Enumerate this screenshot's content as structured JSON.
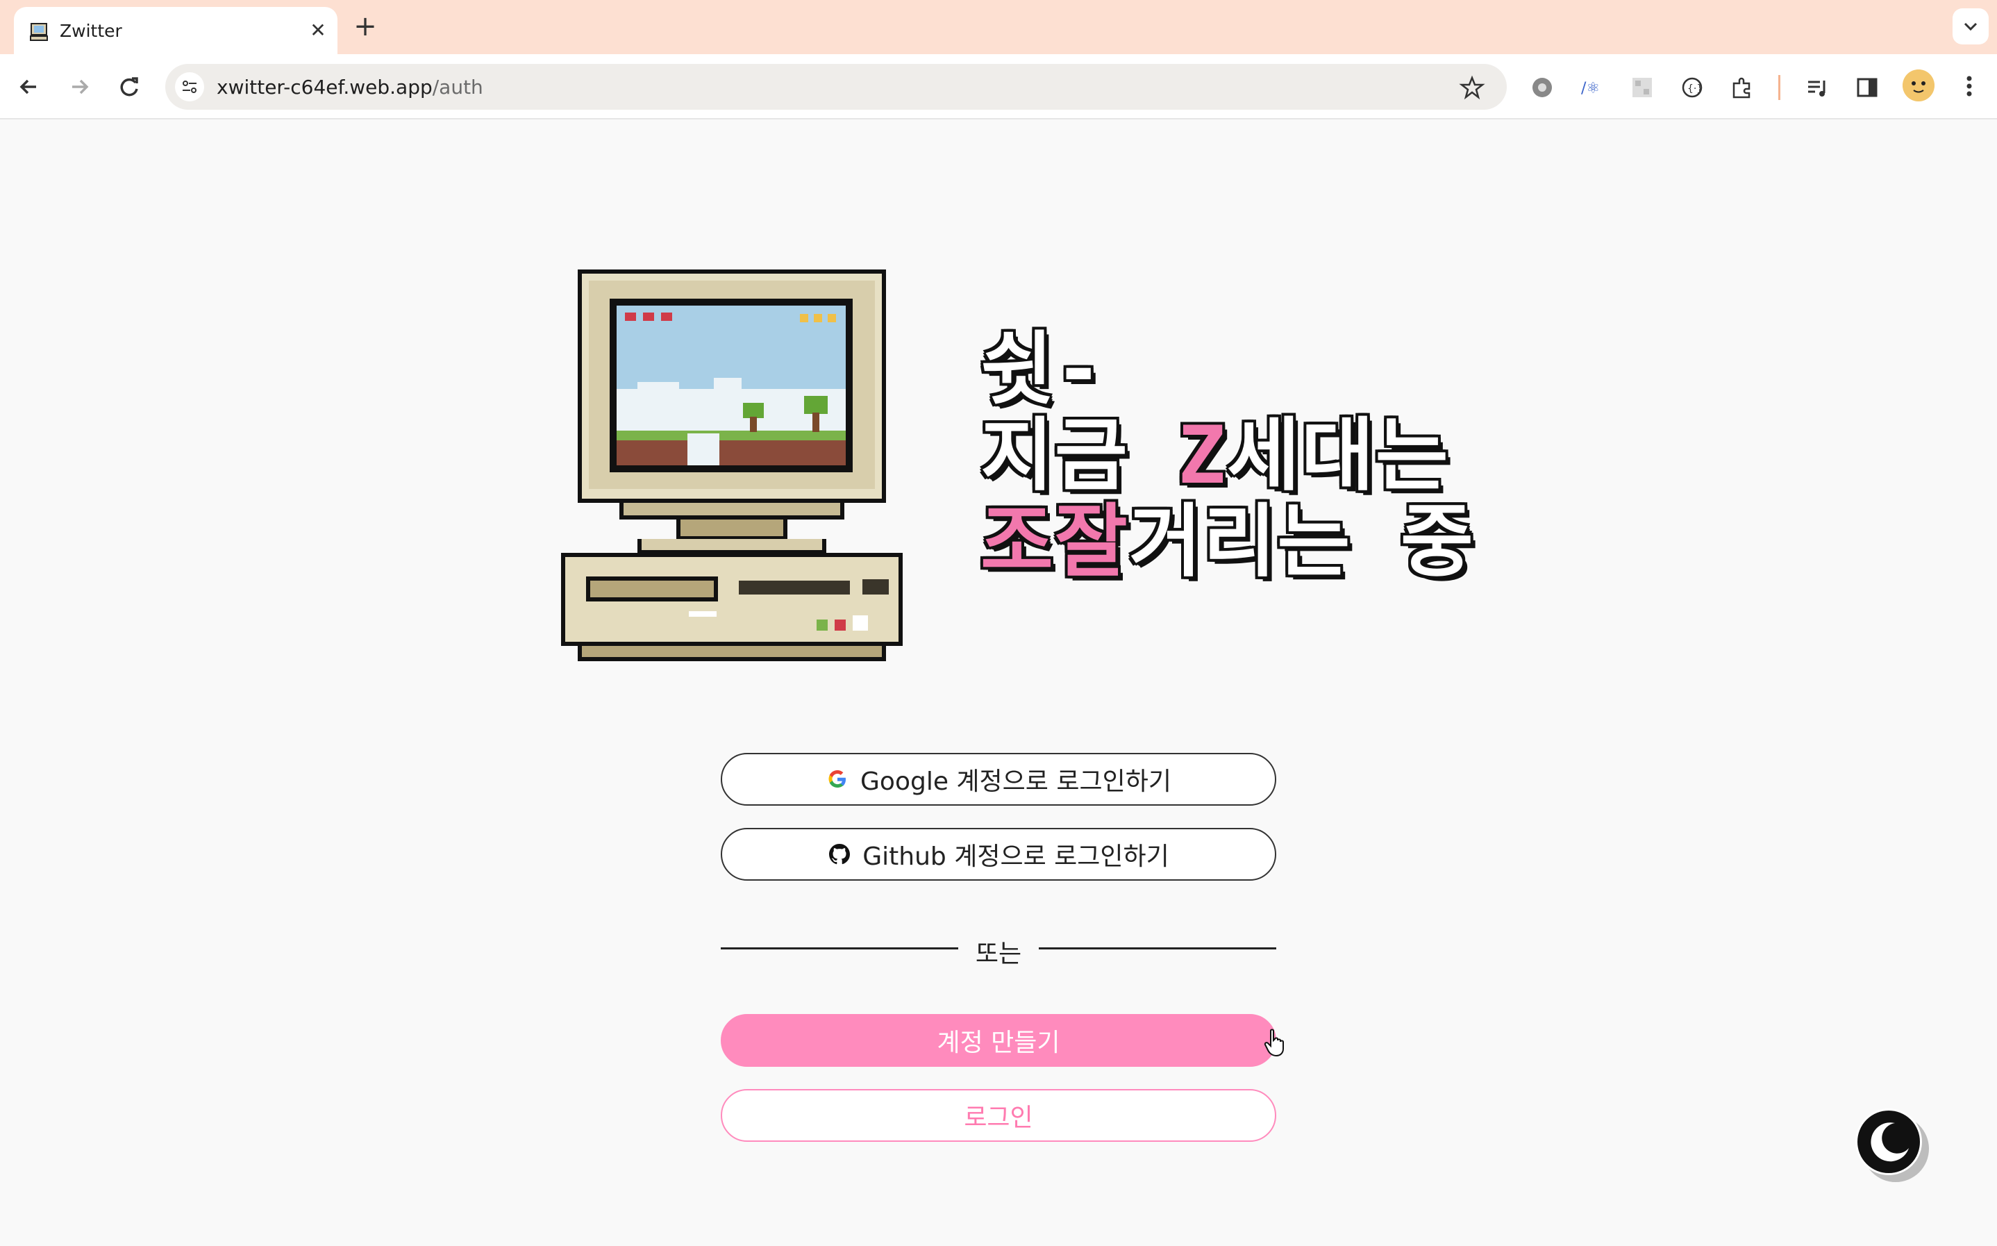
{
  "browser": {
    "tab_title": "Zwitter",
    "url_host": "xwitter-c64ef.web.app",
    "url_path": "/auth"
  },
  "hero": {
    "line1": "쉿-",
    "line2_before": "지금 ",
    "line2_highlight": "Z",
    "line2_after": "세대는",
    "line3_highlight": "조잘",
    "line3_after": "거리는 중"
  },
  "auth": {
    "google_label": "Google 계정으로 로그인하기",
    "github_label": "Github 계정으로 로그인하기",
    "divider_label": "또는",
    "create_account_label": "계정 만들기",
    "login_label": "로그인"
  },
  "colors": {
    "accent_pink": "#ff8bbd",
    "tabbar_bg": "#fde0d2",
    "page_bg": "#f9f9f9"
  },
  "icons": {
    "theme_toggle": "moon-icon"
  }
}
